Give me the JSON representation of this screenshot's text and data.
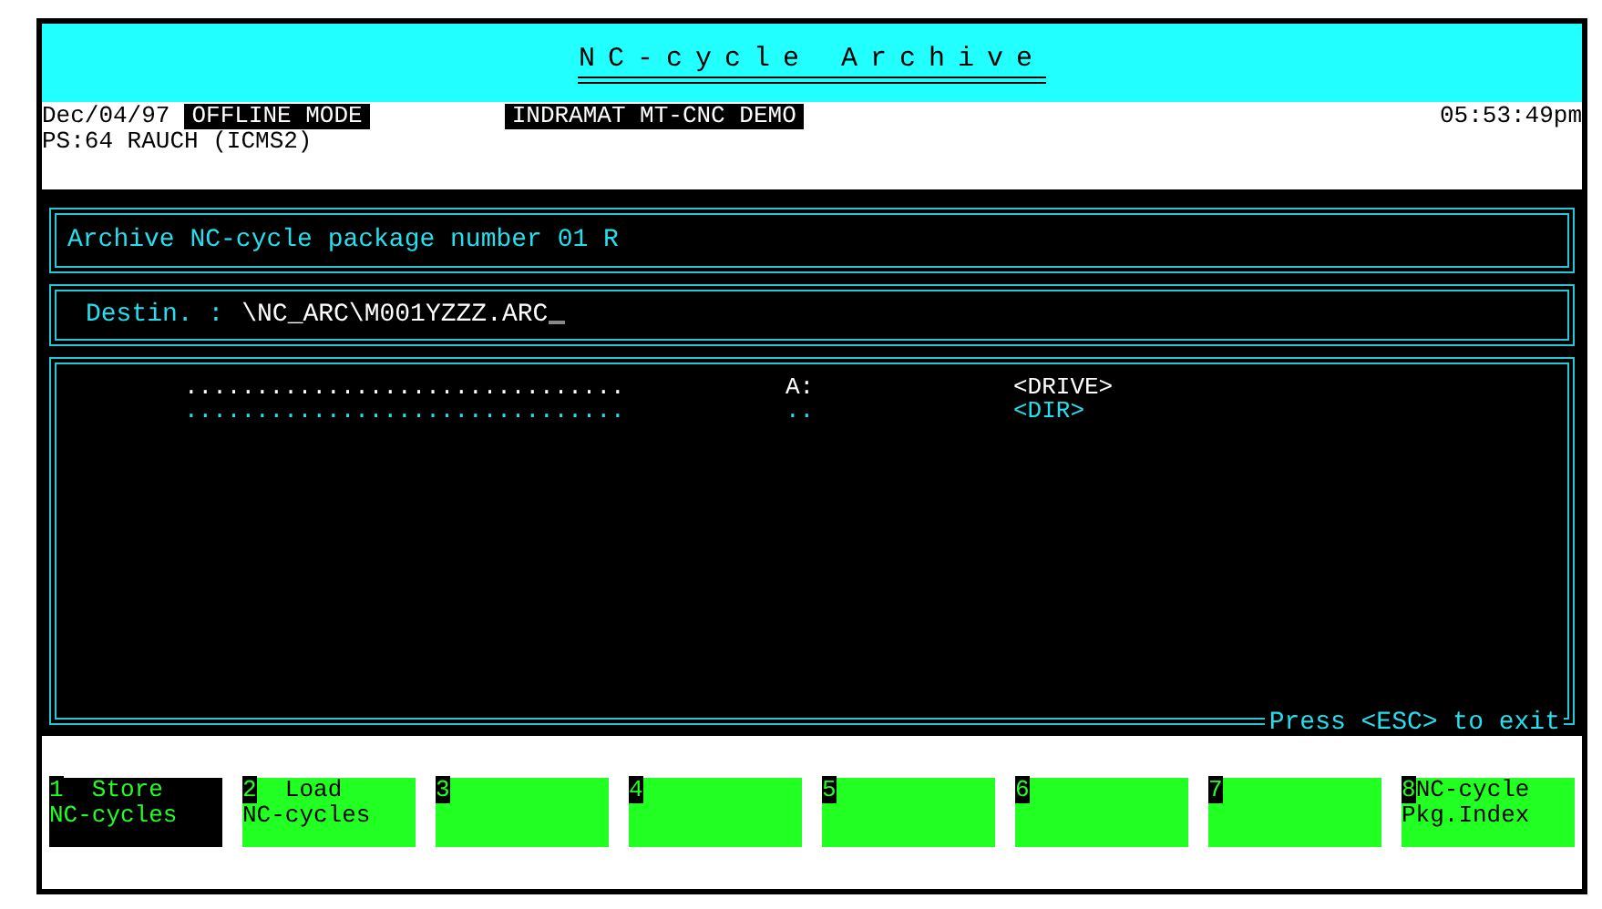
{
  "title": "NC-cycle Archive",
  "header": {
    "date": "Dec/04/97",
    "mode": "OFFLINE MODE",
    "system": "INDRAMAT MT-CNC DEMO",
    "time": "05:53:49pm",
    "station": "PS:64 RAUCH (ICMS2)"
  },
  "task": "Archive NC-cycle package number 01 R",
  "destination": {
    "label": "Destin. :",
    "value": "\\NC_ARC\\M001YZZZ.ARC"
  },
  "entries": [
    {
      "dots": "...............................",
      "name": "A:",
      "type": "<DRIVE>",
      "selected": false
    },
    {
      "dots": "...............................",
      "name": "..",
      "type": "<DIR>",
      "selected": true
    }
  ],
  "exit_hint": "Press <ESC> to exit",
  "function_keys": [
    {
      "number": "1",
      "lines": [
        "Store",
        "NC-cycles"
      ],
      "selected": true
    },
    {
      "number": "2",
      "lines": [
        "Load",
        "NC-cycles"
      ],
      "selected": false
    },
    {
      "number": "3",
      "selected": false
    },
    {
      "number": "4",
      "selected": false
    },
    {
      "number": "5",
      "selected": false
    },
    {
      "number": "6",
      "selected": false
    },
    {
      "number": "7",
      "selected": false
    },
    {
      "number": "8",
      "lines": [
        "NC-cycle",
        "Pkg.Index"
      ],
      "selected": false
    }
  ]
}
